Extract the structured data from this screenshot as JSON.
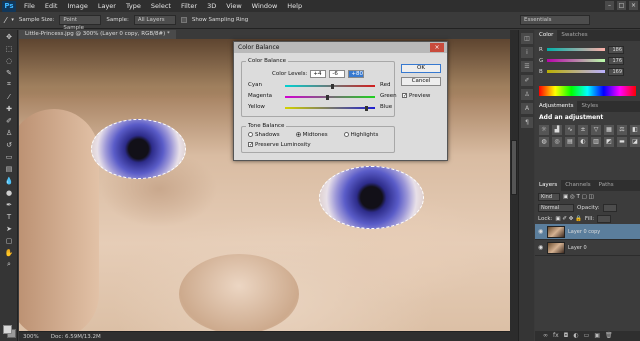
{
  "app": {
    "logo": "Ps"
  },
  "menu": [
    "File",
    "Edit",
    "Image",
    "Layer",
    "Type",
    "Select",
    "Filter",
    "3D",
    "View",
    "Window",
    "Help"
  ],
  "options": {
    "sample_size_label": "Sample Size:",
    "sample_size_value": "Point Sample",
    "sample_label": "Sample:",
    "sample_value": "All Layers",
    "sampling_ring_label": "Show Sampling Ring",
    "workspace": "Essentials"
  },
  "document": {
    "tab_title": "Little-Princess.jpg @ 300% (Layer 0 copy, RGB/8#) *",
    "zoom": "300%",
    "doc_info": "Doc: 6.59M/13.2M"
  },
  "dialog": {
    "title": "Color Balance",
    "group1": "Color Balance",
    "levels_label": "Color Levels:",
    "levels": [
      "+4",
      "-6",
      "+80"
    ],
    "sliders": [
      {
        "left": "Cyan",
        "right": "Red",
        "value": 4,
        "color_left": "#00d2d2",
        "color_right": "#d21e1e"
      },
      {
        "left": "Magenta",
        "right": "Green",
        "value": -6,
        "color_left": "#d200d2",
        "color_right": "#1ed21e"
      },
      {
        "left": "Yellow",
        "right": "Blue",
        "value": 80,
        "color_left": "#d2d200",
        "color_right": "#1e1ed2"
      }
    ],
    "group2": "Tone Balance",
    "tones": [
      "Shadows",
      "Midtones",
      "Highlights"
    ],
    "selected_tone": "Midtones",
    "preserve": "Preserve Luminosity",
    "ok": "OK",
    "cancel": "Cancel",
    "preview": "Preview"
  },
  "panels": {
    "color_tabs": [
      "Color",
      "Swatches"
    ],
    "rgb": [
      {
        "l": "R",
        "v": "186"
      },
      {
        "l": "G",
        "v": "176"
      },
      {
        "l": "B",
        "v": "169"
      }
    ],
    "adj_tabs": [
      "Adjustments",
      "Styles"
    ],
    "adj_title": "Add an adjustment",
    "layer_tabs": [
      "Layers",
      "Channels",
      "Paths"
    ],
    "kind": "Kind",
    "blend": "Normal",
    "opacity_label": "Opacity:",
    "lock_label": "Lock:",
    "fill_label": "Fill:",
    "layers": [
      "Layer 0 copy",
      "Layer 0"
    ]
  }
}
